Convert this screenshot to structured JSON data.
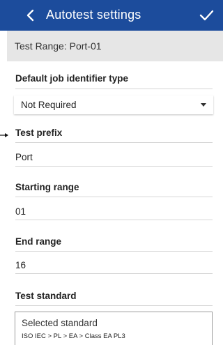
{
  "appbar": {
    "title": "Autotest settings",
    "background": "#1c4c9c"
  },
  "subheader": {
    "text": "Test Range: Port-01"
  },
  "job_identifier": {
    "label": "Default job identifier type",
    "selected": "Not Required"
  },
  "test_prefix": {
    "label": "Test prefix",
    "value": "Port"
  },
  "starting_range": {
    "label": "Starting range",
    "value": "01"
  },
  "end_range": {
    "label": "End range",
    "value": "16"
  },
  "test_standard": {
    "label": "Test standard",
    "box_title": "Selected standard",
    "path": "ISO IEC > PL > EA > Class EA PL3"
  }
}
